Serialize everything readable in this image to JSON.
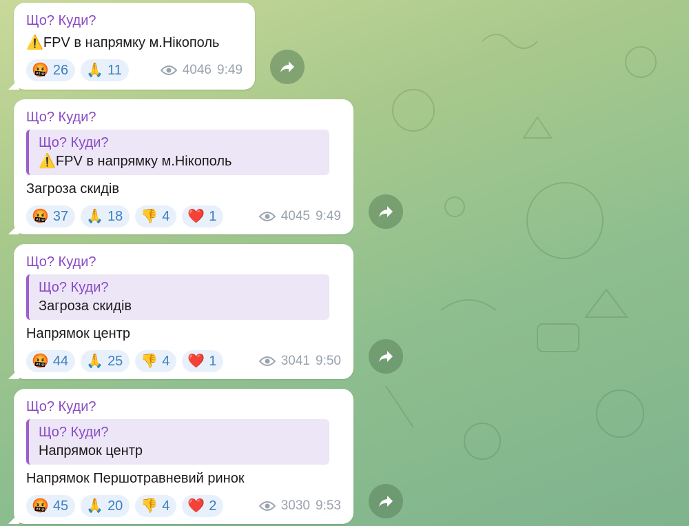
{
  "messages": [
    {
      "sender": "Що? Куди?",
      "text": "⚠️FPV в напрямку м.Нікополь",
      "reactions": [
        {
          "icon": "angry-face-icon",
          "emoji": "🤬",
          "count": "26"
        },
        {
          "icon": "folded-hands-icon",
          "emoji": "🙏",
          "count": "11"
        }
      ],
      "views": "4046",
      "time": "9:49"
    },
    {
      "sender": "Що? Куди?",
      "quote": {
        "sender": "Що? Куди?",
        "text": "⚠️FPV в напрямку м.Нікополь"
      },
      "text": "Загроза скидів",
      "reactions": [
        {
          "icon": "angry-face-icon",
          "emoji": "🤬",
          "count": "37"
        },
        {
          "icon": "folded-hands-icon",
          "emoji": "🙏",
          "count": "18"
        },
        {
          "icon": "thumbs-down-icon",
          "emoji": "👎",
          "count": "4"
        },
        {
          "icon": "red-heart-icon",
          "emoji": "❤️",
          "count": "1"
        }
      ],
      "views": "4045",
      "time": "9:49"
    },
    {
      "sender": "Що? Куди?",
      "quote": {
        "sender": "Що? Куди?",
        "text": "Загроза скидів"
      },
      "text": "Напрямок центр",
      "reactions": [
        {
          "icon": "angry-face-icon",
          "emoji": "🤬",
          "count": "44"
        },
        {
          "icon": "folded-hands-icon",
          "emoji": "🙏",
          "count": "25"
        },
        {
          "icon": "thumbs-down-icon",
          "emoji": "👎",
          "count": "4"
        },
        {
          "icon": "red-heart-icon",
          "emoji": "❤️",
          "count": "1"
        }
      ],
      "views": "3041",
      "time": "9:50"
    },
    {
      "sender": "Що? Куди?",
      "quote": {
        "sender": "Що? Куди?",
        "text": "Напрямок центр"
      },
      "text": "Напрямок Першотравневий ринок",
      "reactions": [
        {
          "icon": "angry-face-icon",
          "emoji": "🤬",
          "count": "45"
        },
        {
          "icon": "folded-hands-icon",
          "emoji": "🙏",
          "count": "20"
        },
        {
          "icon": "thumbs-down-icon",
          "emoji": "👎",
          "count": "4"
        },
        {
          "icon": "red-heart-icon",
          "emoji": "❤️",
          "count": "2"
        }
      ],
      "views": "3030",
      "time": "9:53"
    }
  ],
  "icons": {
    "views": "eye-icon",
    "forward": "forward-arrow-icon"
  },
  "colors": {
    "sender": "#8a4bc4",
    "reaction_count": "#3a7fc0",
    "quote_bg": "#ece6f6",
    "quote_bar": "#9b5fd0"
  }
}
